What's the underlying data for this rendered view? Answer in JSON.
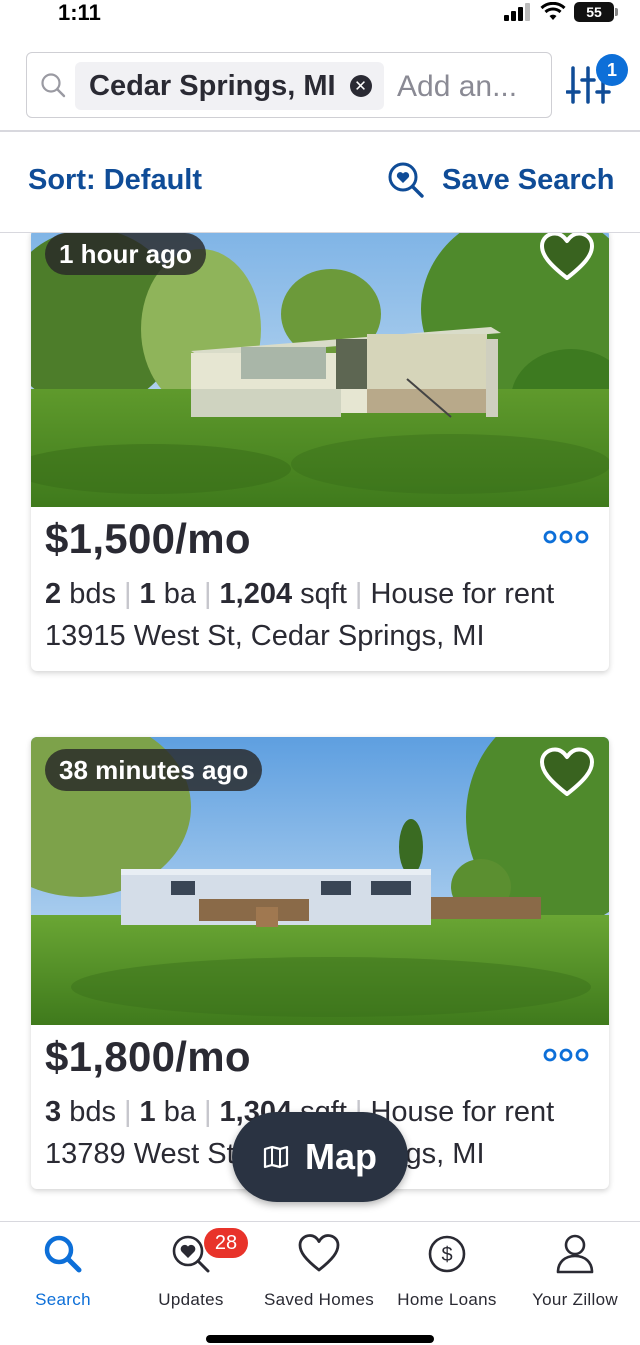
{
  "status_bar": {
    "time": "1:11",
    "battery": "55"
  },
  "search": {
    "chip_label": "Cedar Springs, MI",
    "placeholder": "Add an...",
    "filter_count": "1"
  },
  "sort": {
    "label": "Sort: Default",
    "save_search": "Save Search"
  },
  "listings": [
    {
      "badge": "1 hour ago",
      "price": "$1,500/mo",
      "beds": "2",
      "beds_unit": "bds",
      "baths": "1",
      "baths_unit": "ba",
      "sqft": "1,204",
      "sqft_unit": "sqft",
      "type": "House for rent",
      "address": "13915 West St, Cedar Springs, MI"
    },
    {
      "badge": "38 minutes ago",
      "price": "$1,800/mo",
      "beds": "3",
      "beds_unit": "bds",
      "baths": "1",
      "baths_unit": "ba",
      "sqft": "1,304",
      "sqft_unit": "sqft",
      "type": "House for rent",
      "address": "13789 West St, Cedar Springs, MI"
    }
  ],
  "map_button": {
    "label": "Map"
  },
  "nav": {
    "items": [
      {
        "label": "Search",
        "icon": "search-icon"
      },
      {
        "label": "Updates",
        "icon": "updates-icon"
      },
      {
        "label": "Saved Homes",
        "icon": "heart-icon"
      },
      {
        "label": "Home Loans",
        "icon": "dollar-icon"
      },
      {
        "label": "Your Zillow",
        "icon": "person-icon"
      }
    ],
    "updates_badge": "28"
  },
  "colors": {
    "accent": "#0d6fd8",
    "link": "#0f4c97",
    "badge_red": "#e8332a",
    "map_button": "#2a3342"
  }
}
